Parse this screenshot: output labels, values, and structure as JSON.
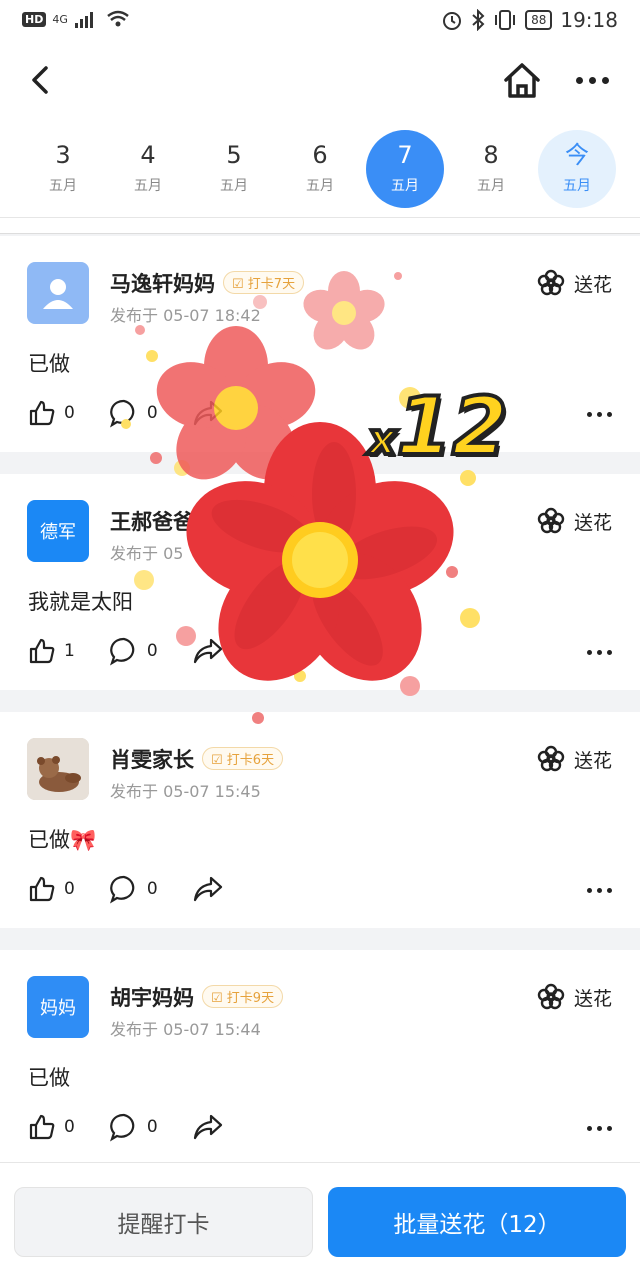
{
  "status_bar": {
    "hd": "HD",
    "network": "4G",
    "battery": "88",
    "time": "19:18"
  },
  "dates": [
    {
      "day": "3",
      "month": "五月",
      "state": "normal"
    },
    {
      "day": "4",
      "month": "五月",
      "state": "normal"
    },
    {
      "day": "5",
      "month": "五月",
      "state": "normal"
    },
    {
      "day": "6",
      "month": "五月",
      "state": "normal"
    },
    {
      "day": "7",
      "month": "五月",
      "state": "selected"
    },
    {
      "day": "8",
      "month": "五月",
      "state": "normal"
    },
    {
      "day": "今",
      "month": "五月",
      "state": "today"
    }
  ],
  "posts": [
    {
      "name": "马逸轩妈妈",
      "badge": "打卡7天",
      "time": "发布于 05-07 18:42",
      "content": "已做",
      "likes": "0",
      "comments": "0",
      "send_flower": "送花",
      "avatar_type": "silhouette",
      "avatar_color": "#8fb9f5"
    },
    {
      "name": "王郝爸爸",
      "badge": "",
      "time": "发布于 05",
      "content": "我就是太阳",
      "likes": "1",
      "comments": "0",
      "send_flower": "送花",
      "avatar_type": "text",
      "avatar_text": "德军",
      "avatar_color": "#1b88f5"
    },
    {
      "name": "肖雯家长",
      "badge": "打卡6天",
      "time": "发布于 05-07 15:45",
      "content": "已做🎀",
      "likes": "0",
      "comments": "0",
      "send_flower": "送花",
      "avatar_type": "photo",
      "avatar_color": "#d9cfc4"
    },
    {
      "name": "胡宇妈妈",
      "badge": "打卡9天",
      "time": "发布于 05-07 15:44",
      "content": "已做",
      "likes": "0",
      "comments": "0",
      "send_flower": "送花",
      "avatar_type": "text",
      "avatar_text": "妈妈",
      "avatar_color": "#2f8df5"
    }
  ],
  "bottom": {
    "remind_label": "提醒打卡",
    "batch_label": "批量送花（12）"
  },
  "overlay": {
    "multiplier_x": "x",
    "multiplier_n": "12"
  },
  "colors": {
    "accent": "#1b88f5",
    "selected_date": "#3a8ef6",
    "today_bg": "#e4f1fd",
    "flower_red": "#e8363a",
    "flower_center": "#ffd21f",
    "badge_text": "#e6a23c"
  }
}
